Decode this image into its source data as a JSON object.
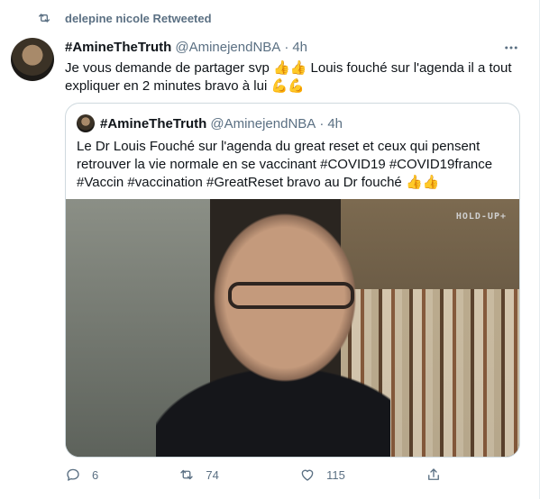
{
  "retweet": {
    "label": "delepine nicole Retweeted",
    "icon": "retweet-icon"
  },
  "tweet": {
    "name": "#AmineTheTruth",
    "handle": "@AminejendNBA",
    "separator": "·",
    "time": "4h",
    "text_before": "Je vous demande de partager svp",
    "emoji_thumbs": "👍👍",
    "text_after": "Louis fouché sur l'agenda il a tout expliquer en 2 minutes bravo à lui",
    "emoji_muscles": "💪💪"
  },
  "quote": {
    "name": "#AmineTheTruth",
    "handle": "@AminejendNBA",
    "separator": "·",
    "time": "4h",
    "text": "Le Dr Louis Fouché sur l'agenda du great reset et ceux qui pensent retrouver la vie normale en se vaccinant #COVID19 #COVID19france #Vaccin #vaccination #GreatReset bravo au Dr fouché",
    "emoji": "👍👍",
    "watermark": "HOLD-UP+"
  },
  "actions": {
    "replies": "6",
    "retweets": "74",
    "likes": "115"
  },
  "colors": {
    "muted": "#5b7083",
    "text": "#0f1419",
    "border": "#cfd9de"
  }
}
